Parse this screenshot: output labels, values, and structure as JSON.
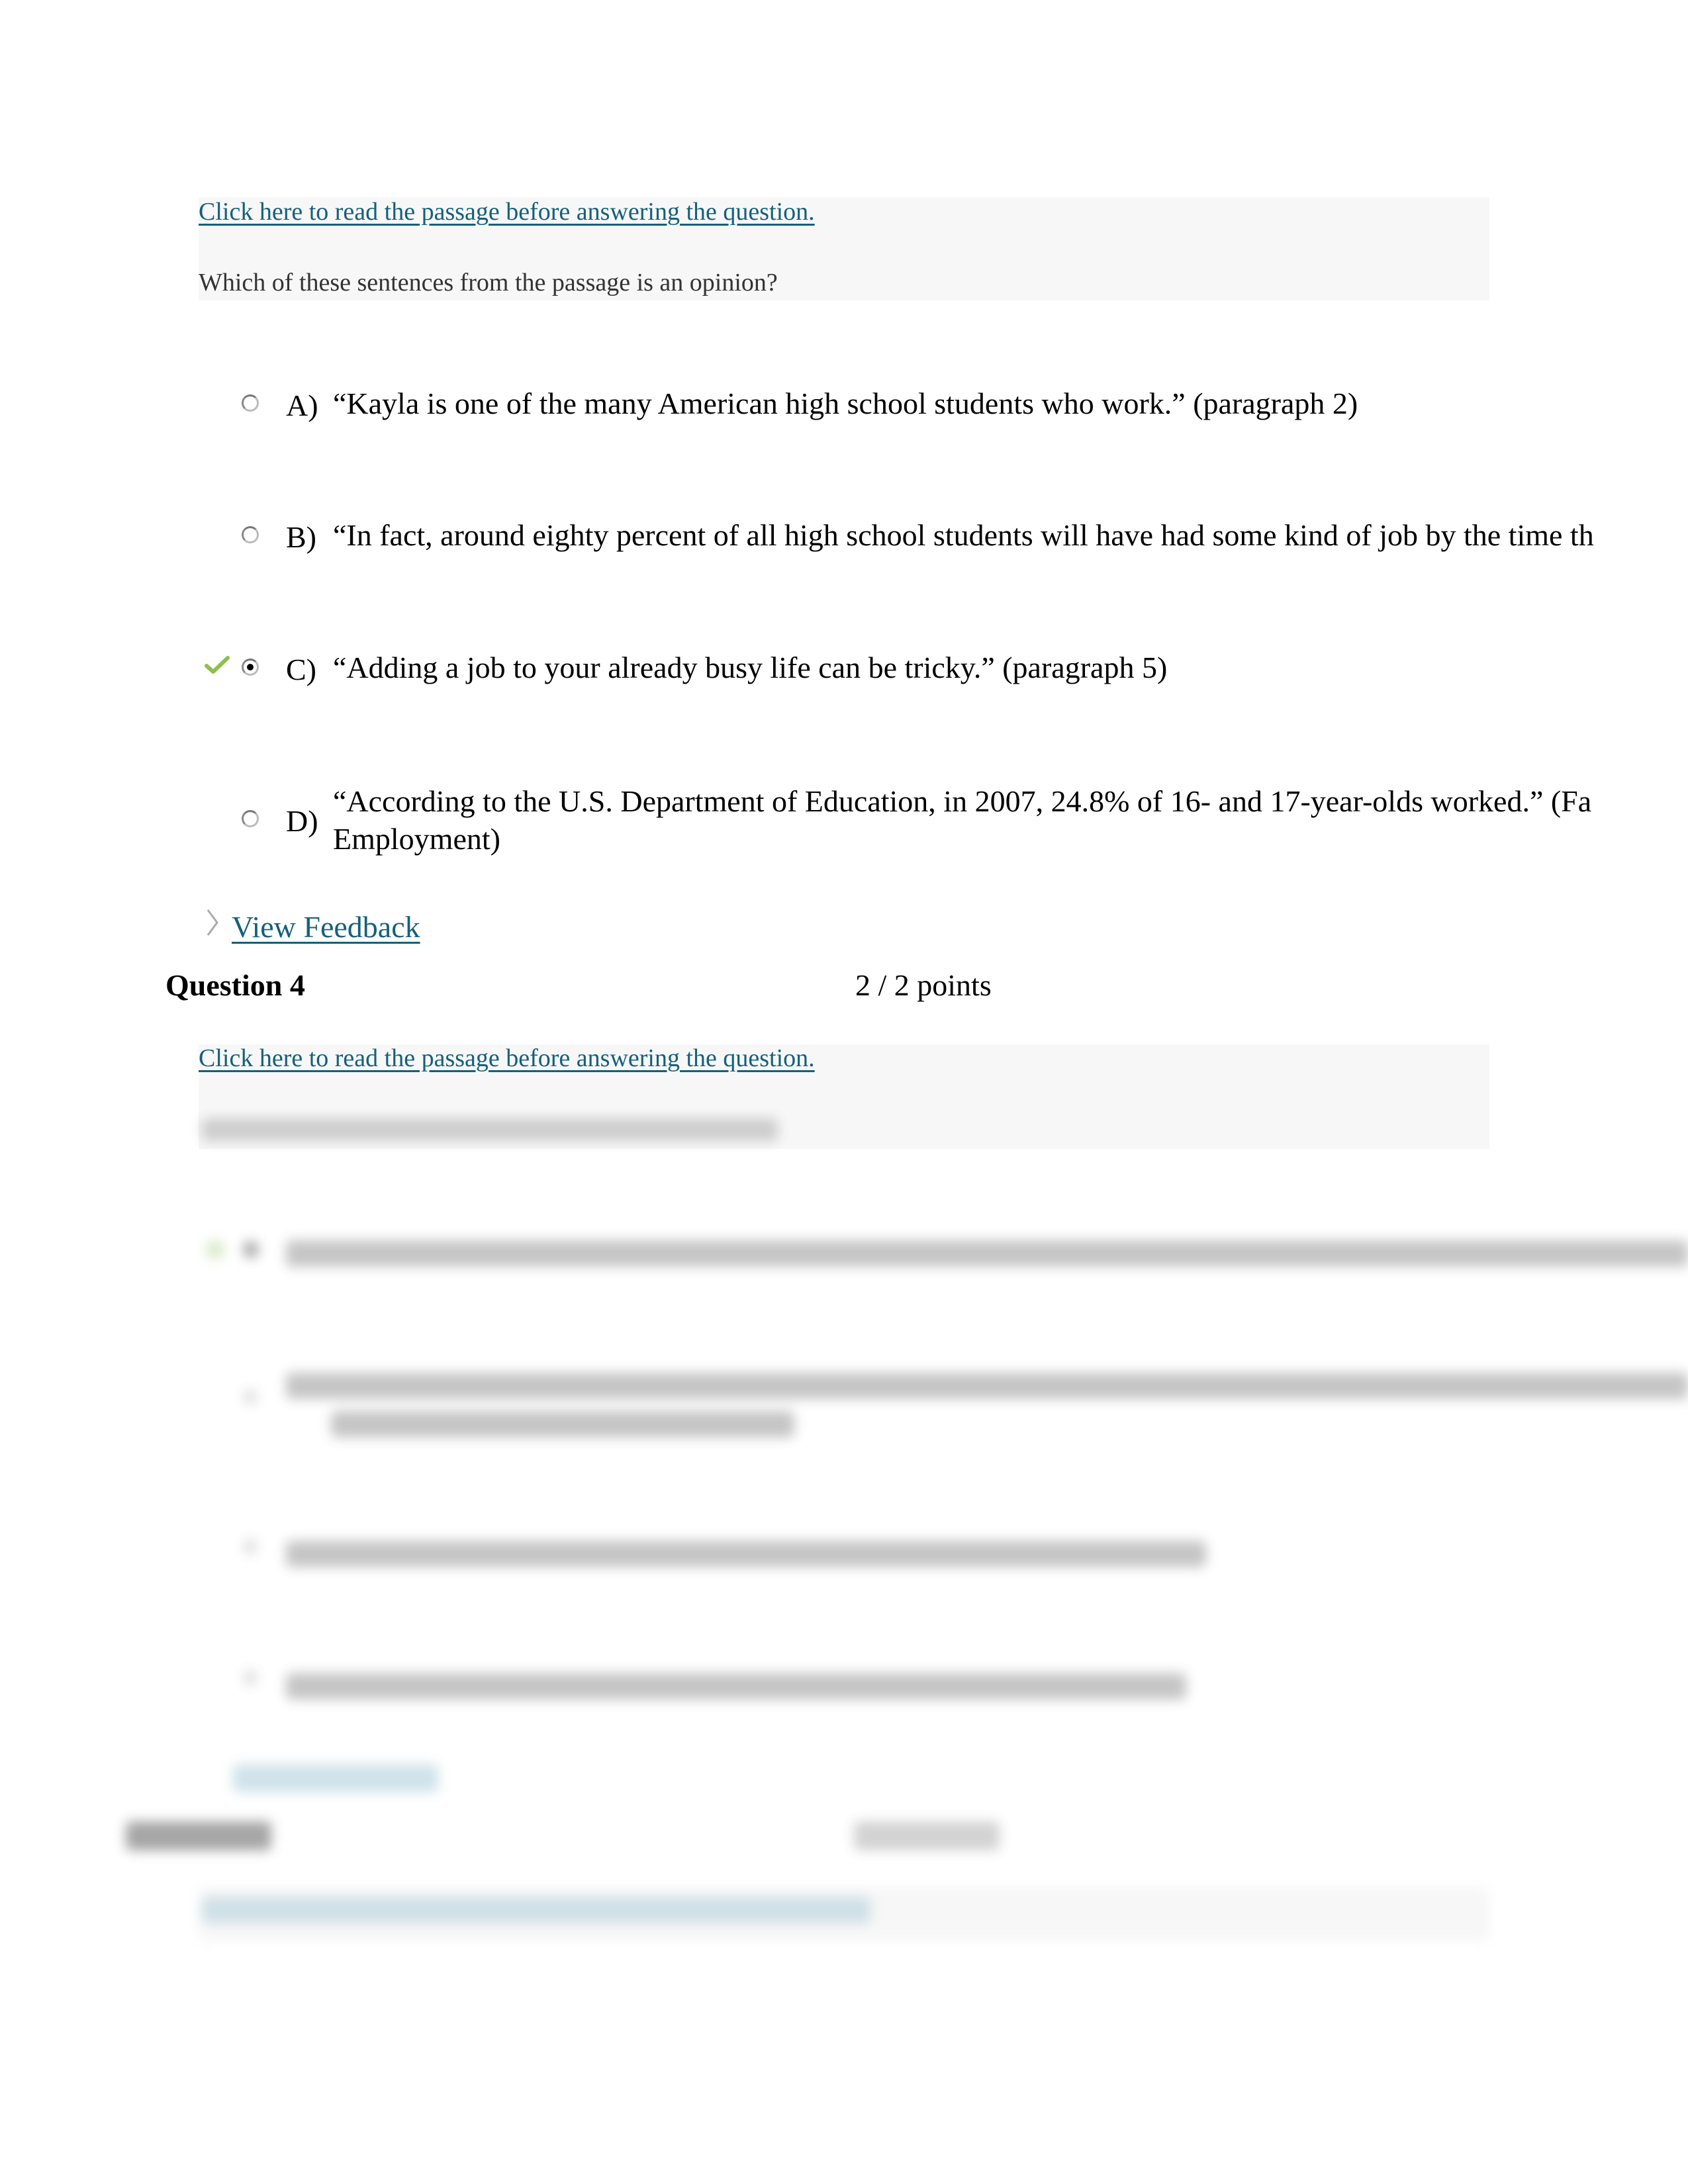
{
  "question3": {
    "passage_link": "Click here to read the passage before answering the question.",
    "prompt": "Which of these sentences from the passage is an opinion?",
    "options": [
      {
        "letter": "A)",
        "text": "“Kayla is one of the many American high school students who work.” (paragraph 2)",
        "selected": false,
        "correct": false
      },
      {
        "letter": "B)",
        "text": "“In fact, around eighty percent of all high school students will have had some kind of job by the time th",
        "selected": false,
        "correct": false
      },
      {
        "letter": "C)",
        "text": "“Adding a job to your already busy life can be tricky.” (paragraph 5)",
        "selected": true,
        "correct": true
      },
      {
        "letter": "D)",
        "text_line1": "“According to the U.S. Department of Education, in 2007, 24.8% of 16- and 17-year-olds worked.” (Fa",
        "text_line2": "Employment)",
        "selected": false,
        "correct": false
      }
    ],
    "feedback_label": "View Feedback"
  },
  "question4": {
    "title": "Question 4",
    "points": "2 / 2 points",
    "passage_link": "Click here to read the passage before answering the question."
  },
  "colors": {
    "link": "#15607a",
    "correct_check": "#8cc04b",
    "prompt_background": "#f7f7f7"
  }
}
